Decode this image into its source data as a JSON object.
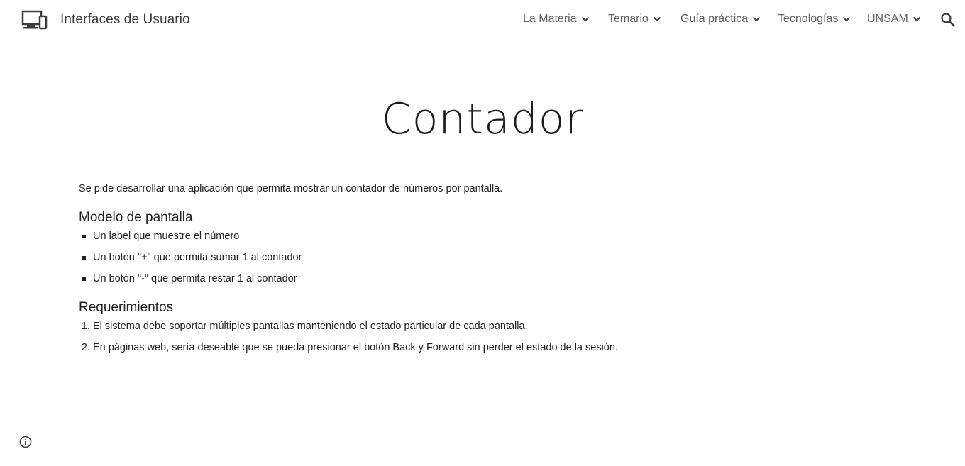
{
  "header": {
    "site_title": "Interfaces de Usuario",
    "logo_icon": "devices-icon",
    "nav": [
      {
        "label": "La Materia",
        "icon": "chevron-down-icon"
      },
      {
        "label": "Temario",
        "icon": "chevron-down-icon"
      },
      {
        "label": "Guía práctica",
        "icon": "chevron-down-icon"
      },
      {
        "label": "Tecnologías",
        "icon": "chevron-down-icon"
      },
      {
        "label": "UNSAM",
        "icon": "chevron-down-icon"
      }
    ],
    "search_icon": "search-icon"
  },
  "page": {
    "title": "Contador",
    "intro": "Se pide desarrollar una aplicación que permita mostrar un contador de números por pantalla.",
    "sections": [
      {
        "heading": "Modelo de pantalla",
        "list_type": "bullet",
        "items": [
          "Un label que muestre el número",
          "Un botón \"+\" que permita sumar 1 al contador",
          "Un botón \"-\" que permita restar 1 al contador"
        ]
      },
      {
        "heading": "Requerimientos",
        "list_type": "numbered",
        "items": [
          "El sistema debe soportar múltiples pantallas manteniendo el estado particular de cada pantalla.",
          "En páginas web, sería deseable que se pueda presionar el botón Back y Forward sin perder el estado de la sesión."
        ]
      }
    ]
  },
  "footer": {
    "info_icon": "info-icon"
  },
  "colors": {
    "text": "#212121",
    "nav_text": "#5f5f5f",
    "background": "#ffffff"
  }
}
